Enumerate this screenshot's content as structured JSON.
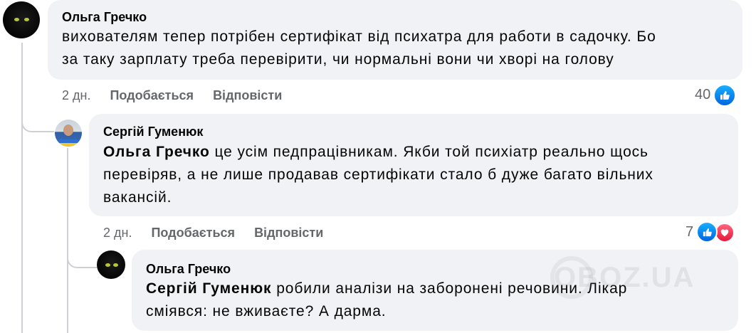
{
  "comments": [
    {
      "author": "Ольга Гречко",
      "avatar_icon": "black-cat-avatar",
      "lines": [
        "вихователям тепер потрібен сертифікат від психатра для работи в садочку. Бо",
        "за таку зарплату треба перевірити, чи нормальні вони чи хворі на голову"
      ],
      "time": "2 дн.",
      "like_label": "Подобається",
      "reply_label": "Відповісти",
      "reaction_count": "40",
      "reactions": [
        "like-icon"
      ]
    },
    {
      "author": "Сергій Гуменюк",
      "avatar_icon": "man-portrait-avatar",
      "mention": "Ольга Гречко",
      "lines": [
        " це усім педпрацівникам. Якби той психіатр реально щось",
        "перевіряв, а не лише продавав сертифікати стало б дуже багато вільних",
        "вакансій."
      ],
      "time": "2 дн.",
      "like_label": "Подобається",
      "reply_label": "Відповісти",
      "reaction_count": "7",
      "reactions": [
        "like-icon",
        "love-icon"
      ]
    },
    {
      "author": "Ольга Гречко",
      "avatar_icon": "black-cat-avatar",
      "mention": "Сергій Гуменюк",
      "lines": [
        " робили аналізи на заборонені речовини. Лікар",
        "сміявся: не вживаєте? А дарма."
      ]
    }
  ],
  "watermark": "OBOZ.UA",
  "colors": {
    "bubble": "#f0f2f5",
    "meta": "#65676b",
    "like": "#0866ff",
    "love": "#f33e58"
  }
}
